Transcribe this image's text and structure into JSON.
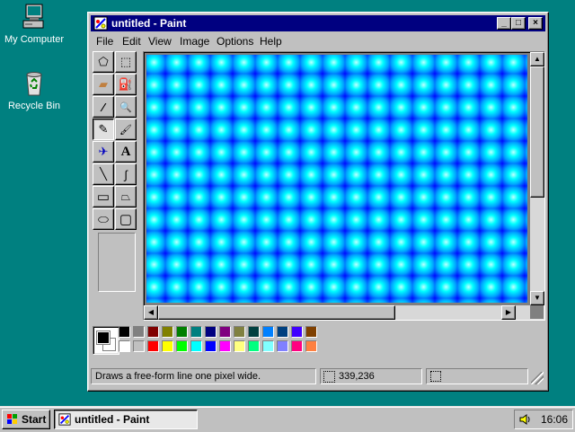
{
  "desktop": {
    "icons": [
      {
        "label": "My Computer",
        "icon": "my-computer-icon"
      },
      {
        "label": "Recycle Bin",
        "icon": "recycle-bin-icon"
      }
    ]
  },
  "window": {
    "title": "untitled - Paint",
    "buttons": {
      "minimize": "_",
      "maximize": "□",
      "close": "×"
    },
    "menu": [
      "File",
      "Edit",
      "View",
      "Image",
      "Options",
      "Help"
    ],
    "menu_underline": [
      "F",
      "E",
      "V",
      "I",
      "O",
      "H"
    ]
  },
  "toolbox": {
    "tools": [
      {
        "name": "free-form-select",
        "glyph": "⬠"
      },
      {
        "name": "select",
        "glyph": "⬚"
      },
      {
        "name": "eraser",
        "glyph": "▰"
      },
      {
        "name": "fill-with-color",
        "glyph": "⛽"
      },
      {
        "name": "pick-color",
        "glyph": "⁄"
      },
      {
        "name": "magnifier",
        "glyph": "🔍"
      },
      {
        "name": "pencil",
        "glyph": "✎",
        "active": true
      },
      {
        "name": "brush",
        "glyph": "🖌"
      },
      {
        "name": "airbrush",
        "glyph": "✈"
      },
      {
        "name": "text",
        "glyph": "A"
      },
      {
        "name": "line",
        "glyph": "╲"
      },
      {
        "name": "curve",
        "glyph": "∫"
      },
      {
        "name": "rectangle",
        "glyph": "▭"
      },
      {
        "name": "polygon",
        "glyph": "⏢"
      },
      {
        "name": "ellipse",
        "glyph": "⬭"
      },
      {
        "name": "rounded-rectangle",
        "glyph": "▢"
      }
    ]
  },
  "palette": {
    "foreground": "#000000",
    "background": "#ffffff",
    "row1": [
      "#000000",
      "#808080",
      "#800000",
      "#808000",
      "#008000",
      "#008080",
      "#000080",
      "#800080",
      "#808040",
      "#004040",
      "#0080ff",
      "#004080",
      "#4000ff",
      "#804000"
    ],
    "row2": [
      "#ffffff",
      "#c0c0c0",
      "#ff0000",
      "#ffff00",
      "#00ff00",
      "#00ffff",
      "#0000ff",
      "#ff00ff",
      "#ffff80",
      "#00ff80",
      "#80ffff",
      "#8080ff",
      "#ff0080",
      "#ff8040"
    ]
  },
  "status": {
    "help_text": "Draws a free-form line one pixel wide.",
    "coordinates": "339,236",
    "selection_size": ""
  },
  "taskbar": {
    "start_label": "Start",
    "task_label": "untitled - Paint",
    "clock": "16:06"
  },
  "colors": {
    "desktop": "#008080",
    "titlebar": "#000080",
    "face": "#c0c0c0"
  }
}
